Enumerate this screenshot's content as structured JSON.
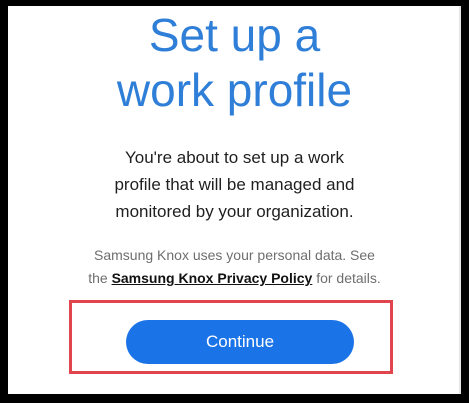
{
  "title": {
    "line1": "Set up a",
    "line2": "work profile"
  },
  "description": {
    "line1": "You're about to set up a work",
    "line2": "profile that will be managed and",
    "line3": "monitored by your organization."
  },
  "privacy": {
    "line1": "Samsung Knox uses your personal data. See",
    "prefix": "the ",
    "link_text": "Samsung Knox Privacy Policy",
    "suffix": " for details."
  },
  "continue_button": {
    "label": "Continue"
  },
  "colors": {
    "title": "#2f7fd8",
    "button": "#1b73e8",
    "highlight": "#e0444c"
  }
}
